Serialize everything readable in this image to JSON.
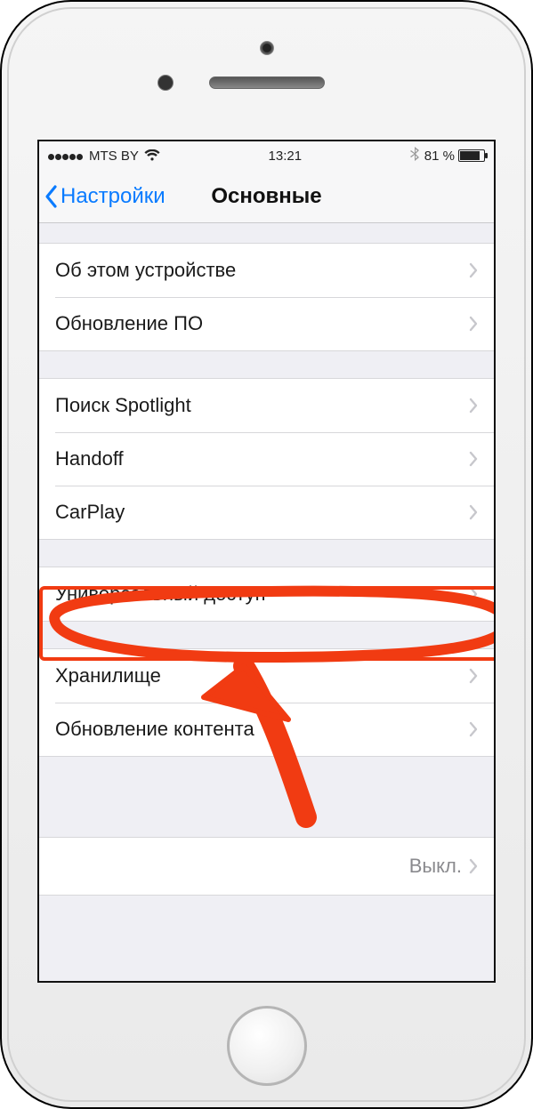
{
  "status": {
    "carrier": "MTS BY",
    "time": "13:21",
    "battery_pct": "81 %"
  },
  "nav": {
    "back_label": "Настройки",
    "title": "Основные"
  },
  "groups": [
    {
      "items": [
        {
          "label": "Об этом устройстве"
        },
        {
          "label": "Обновление ПО"
        }
      ]
    },
    {
      "items": [
        {
          "label": "Поиск Spotlight"
        },
        {
          "label": "Handoff"
        },
        {
          "label": "CarPlay"
        }
      ]
    },
    {
      "items": [
        {
          "label": "Универсальный доступ"
        }
      ]
    },
    {
      "items": [
        {
          "label": "Хранилище"
        },
        {
          "label": "Обновление контента"
        }
      ]
    },
    {
      "items": [
        {
          "label": "",
          "value": "Выкл."
        }
      ]
    }
  ]
}
